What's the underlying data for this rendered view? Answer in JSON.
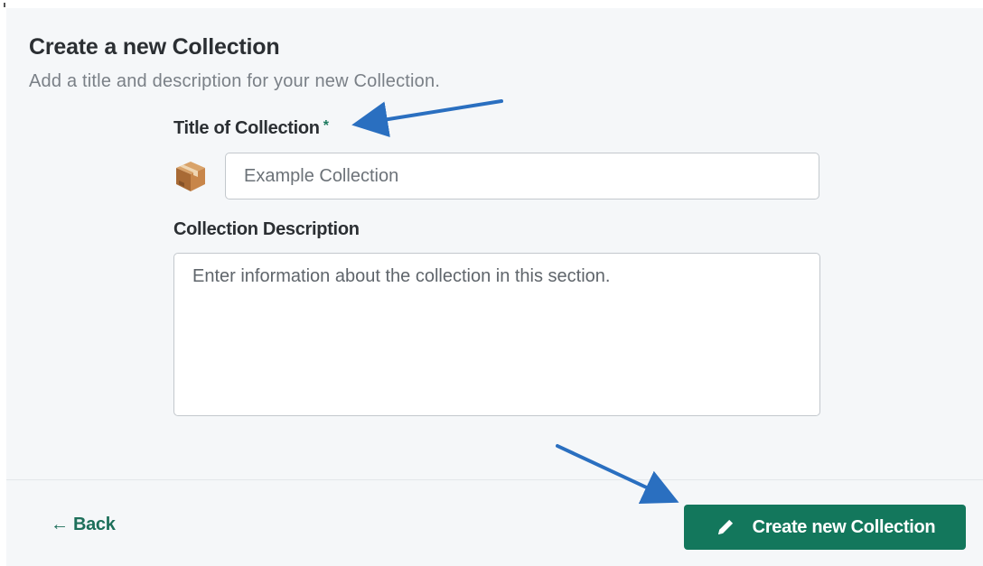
{
  "dialog": {
    "title": "Create a new Collection",
    "subtitle": "Add a title and description for your new Collection."
  },
  "form": {
    "title_label": "Title of Collection",
    "required_marker": "*",
    "title_placeholder": "Example Collection",
    "title_icon": "package-box-icon",
    "description_label": "Collection Description",
    "description_placeholder": "Enter information about the collection in this section."
  },
  "footer": {
    "back_label": "← Back",
    "create_label": "Create new Collection",
    "create_icon": "pencil-icon"
  },
  "colors": {
    "accent": "#13775c",
    "annotation_arrow": "#2a6fc0",
    "panel_background": "#f5f7f9"
  }
}
